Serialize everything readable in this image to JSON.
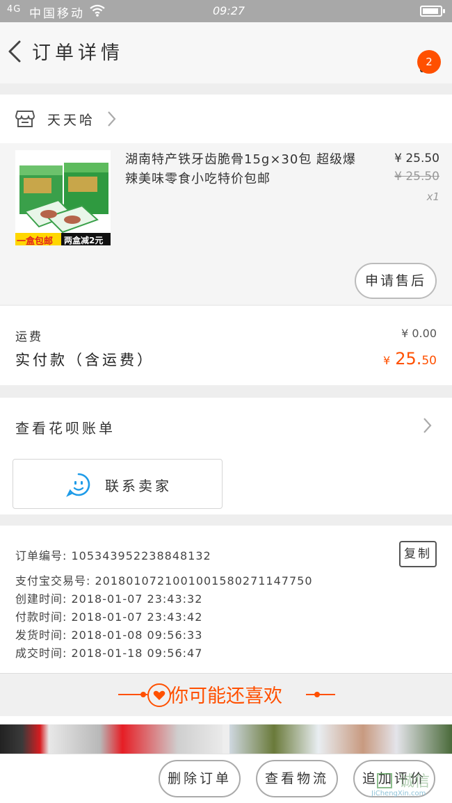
{
  "status_bar": {
    "signal": "4G",
    "carrier": "中国移动",
    "time": "09:27",
    "battery_level": 0.9
  },
  "header": {
    "title": "订单详情",
    "badge_count": "2"
  },
  "shop": {
    "name": "天天哈"
  },
  "product": {
    "title": "湖南特产铁牙齿脆骨15g×30包 超级爆辣美味零食小吃特价包邮",
    "price": "¥ 25.50",
    "original_price": "¥ 25.50",
    "quantity": "x1",
    "image_caption_left": "一盒包邮",
    "image_caption_right": "两盒减2元",
    "aftersale_label": "申请售后"
  },
  "summary": {
    "shipping_label": "运费",
    "shipping_value": "¥ 0.00",
    "paid_label": "实付款（含运费）",
    "paid_currency": "¥",
    "paid_int": "25.",
    "paid_dec": "50"
  },
  "huabei": {
    "label": "查看花呗账单"
  },
  "contact": {
    "label": "联系卖家"
  },
  "order_info": {
    "order_no": "订单编号: 105343952238848132",
    "alipay_no": "支付宝交易号: 2018010721001001580271147750",
    "created": "创建时间: 2018-01-07 23:43:32",
    "paid": "付款时间: 2018-01-07 23:43:42",
    "shipped": "发货时间: 2018-01-08 09:56:33",
    "completed": "成交时间: 2018-01-18 09:56:47",
    "copy_label": "复制"
  },
  "recommend": {
    "title": "你可能还喜欢"
  },
  "bottom_bar": {
    "delete_label": "删除订单",
    "logistics_label": "查看物流",
    "review_label": "追加评价"
  },
  "watermark": {
    "brand": "诚信",
    "url": "JiChengXin.com"
  },
  "colors": {
    "accent": "#ff5000",
    "contact_blue": "#1e9be8"
  }
}
